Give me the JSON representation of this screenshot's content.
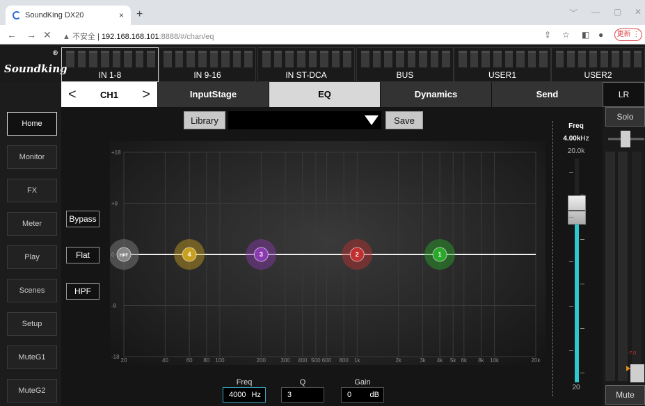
{
  "browser": {
    "tab_title": "SoundKing DX20",
    "tab_close": "×",
    "new_tab": "+",
    "url_warning": "▲ 不安全",
    "url_host": "192.168.168.101",
    "url_rest": ":8888/#/chan/eq",
    "update_label": "更新 ⋮"
  },
  "logo": {
    "text": "Soundking",
    "reg": "®"
  },
  "banks": [
    {
      "label": "IN 1-8",
      "selected": true
    },
    {
      "label": "IN 9-16",
      "selected": false
    },
    {
      "label": "IN ST-DCA",
      "selected": false
    },
    {
      "label": "BUS",
      "selected": false
    },
    {
      "label": "USER1",
      "selected": false
    },
    {
      "label": "USER2",
      "selected": false
    }
  ],
  "channel": {
    "prev": "<",
    "name": "CH1",
    "next": ">"
  },
  "tabs": [
    {
      "label": "InputStage",
      "active": false
    },
    {
      "label": "EQ",
      "active": true
    },
    {
      "label": "Dynamics",
      "active": false
    },
    {
      "label": "Send",
      "active": false
    }
  ],
  "lr_label": "LR",
  "sidebar": [
    {
      "label": "Home",
      "active": true
    },
    {
      "label": "Monitor",
      "active": false
    },
    {
      "label": "FX",
      "active": false
    },
    {
      "label": "Meter",
      "active": false
    },
    {
      "label": "Play",
      "active": false
    },
    {
      "label": "Scenes",
      "active": false
    },
    {
      "label": "Setup",
      "active": false
    },
    {
      "label": "MuteG1",
      "active": false
    },
    {
      "label": "MuteG2",
      "active": false
    }
  ],
  "library": {
    "button": "Library",
    "selected": "",
    "save": "Save"
  },
  "side_buttons": {
    "bypass": "Bypass",
    "flat": "Flat",
    "hpf": "HPF"
  },
  "eq_graph": {
    "gain_ticks": [
      "+18",
      "+9",
      "0",
      "-9",
      "-18"
    ],
    "freq_ticks": [
      "20",
      "40",
      "60",
      "80",
      "100",
      "200",
      "300",
      "400",
      "500",
      "600",
      "800",
      "1k",
      "2k",
      "3k",
      "4k",
      "5k",
      "6k",
      "8k",
      "10k",
      "20k"
    ],
    "bands": [
      {
        "label": "HPF",
        "freq": 20,
        "gain": 0,
        "color": "#888888"
      },
      {
        "label": "4",
        "freq": 60,
        "gain": 0,
        "color": "#c8a020"
      },
      {
        "label": "3",
        "freq": 200,
        "gain": 0,
        "color": "#8a3ab0"
      },
      {
        "label": "2",
        "freq": 1000,
        "gain": 0,
        "color": "#c03030"
      },
      {
        "label": "1",
        "freq": 4000,
        "gain": 0,
        "color": "#2aa82a"
      }
    ]
  },
  "params": {
    "freq_label": "Freq",
    "freq_value": "4000",
    "freq_unit": "Hz",
    "q_label": "Q",
    "q_value": "3",
    "gain_label": "Gain",
    "gain_value": "0",
    "gain_unit": "dB"
  },
  "freq_fader": {
    "title": "Freq",
    "value_num": "4.00k",
    "value_unit": "Hz",
    "max": "20.0k",
    "min": "20",
    "level": 0.77
  },
  "strip": {
    "solo": "Solo",
    "mute": "Mute",
    "fader_readout": "-7.0"
  }
}
